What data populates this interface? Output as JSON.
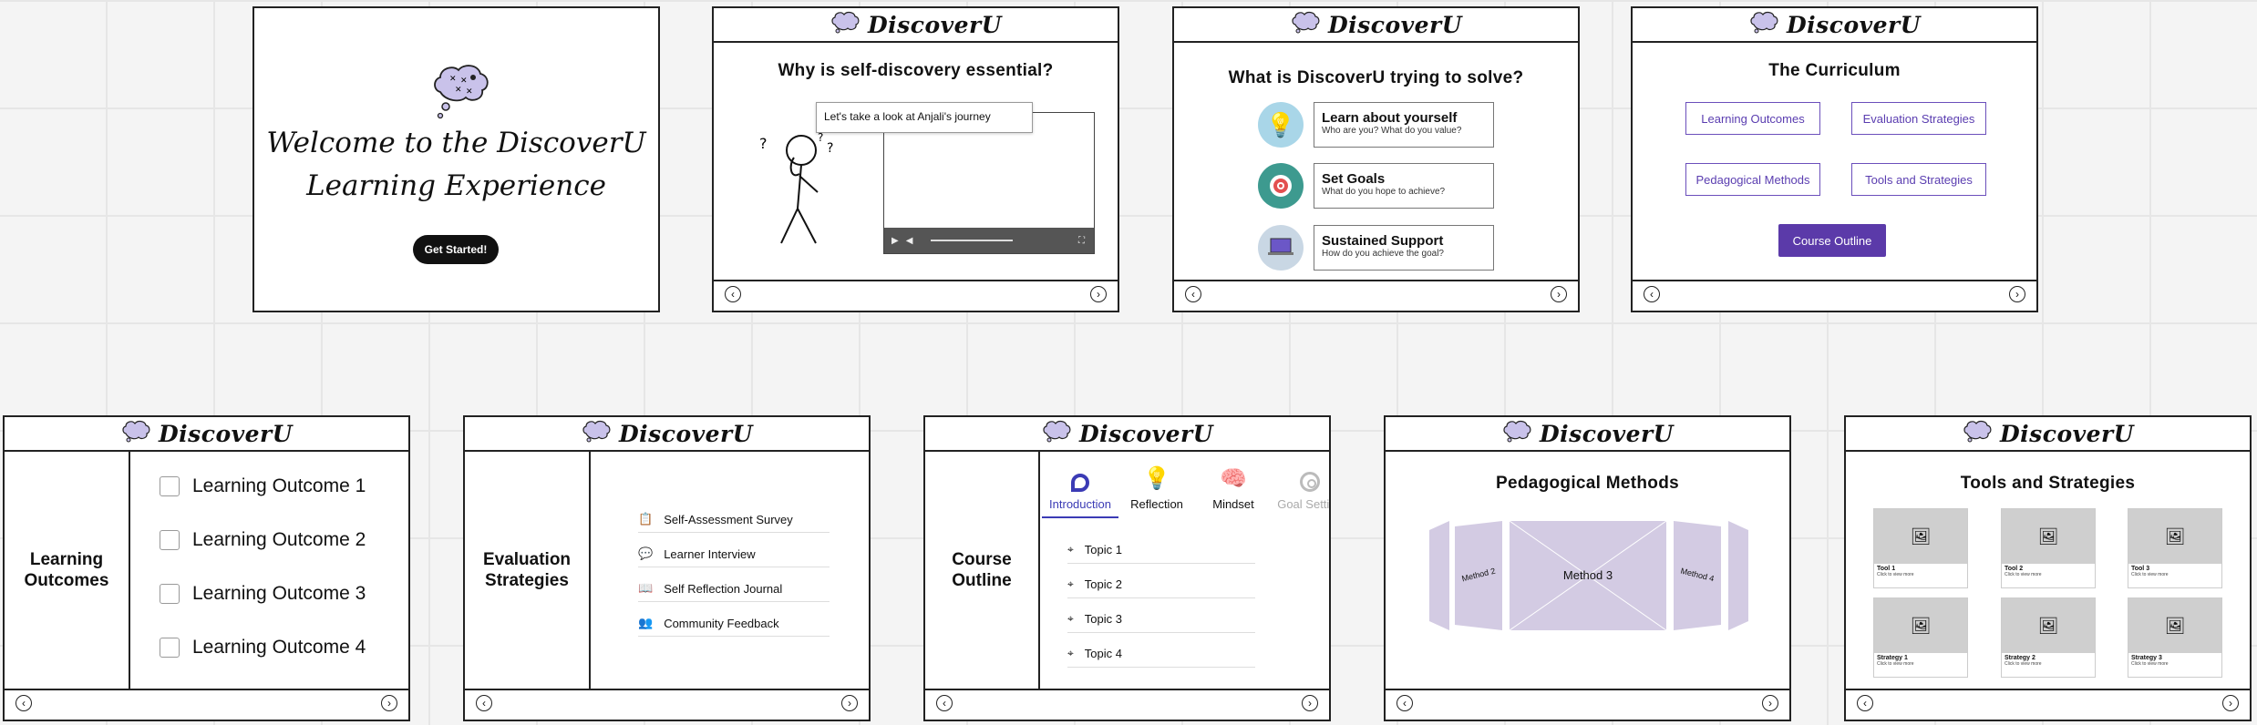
{
  "brand": "DiscoverU",
  "slide1": {
    "title_line1": "Welcome to the DiscoverU",
    "title_line2": "Learning Experience",
    "button": "Get Started!"
  },
  "slide2": {
    "title": "Why is self-discovery essential?",
    "caption": "Let's take a look at Anjali's journey"
  },
  "slide3": {
    "title": "What is DiscoverU trying to solve?",
    "cards": [
      {
        "title": "Learn about yourself",
        "subtitle": "Who are you? What do you value?",
        "icon": "lightbulb-icon",
        "color": "#a9d6e8"
      },
      {
        "title": "Set Goals",
        "subtitle": "What do you hope to achieve?",
        "icon": "target-icon",
        "color": "#3d9a8f"
      },
      {
        "title": "Sustained Support",
        "subtitle": "How do you achieve the goal?",
        "icon": "laptop-icon",
        "color": "#c9d7e4"
      }
    ]
  },
  "slide4": {
    "title": "The Curriculum",
    "buttons": [
      "Learning Outcomes",
      "Evaluation Strategies",
      "Pedagogical Methods",
      "Tools and Strategies"
    ],
    "primary": "Course Outline",
    "accent": "#5b3aa9"
  },
  "slide5": {
    "sidebar_line1": "Learning",
    "sidebar_line2": "Outcomes",
    "items": [
      "Learning Outcome 1",
      "Learning Outcome 2",
      "Learning Outcome 3",
      "Learning Outcome 4"
    ]
  },
  "slide6": {
    "sidebar_line1": "Evaluation",
    "sidebar_line2": "Strategies",
    "items": [
      {
        "label": "Self-Assessment Survey",
        "icon": "clipboard-icon"
      },
      {
        "label": "Learner Interview",
        "icon": "chat-icon"
      },
      {
        "label": "Self Reflection Journal",
        "icon": "book-icon"
      },
      {
        "label": "Community Feedback",
        "icon": "people-icon"
      }
    ]
  },
  "slide7": {
    "sidebar_line1": "Course",
    "sidebar_line2": "Outline",
    "tabs": [
      {
        "label": "Introduction",
        "icon": "chat-bubble-icon",
        "active": true
      },
      {
        "label": "Reflection",
        "icon": "lightbulb-icon",
        "active": false
      },
      {
        "label": "Mindset",
        "icon": "brain-icon",
        "active": false
      },
      {
        "label": "Goal Setting",
        "icon": "target-icon",
        "active": false
      }
    ],
    "topics": [
      "Topic 1",
      "Topic 2",
      "Topic 3",
      "Topic 4"
    ],
    "active_color": "#3b3bb5"
  },
  "slide8": {
    "title": "Pedagogical Methods",
    "center": "Method 3",
    "left": "Method 2",
    "right": "Method 4",
    "color": "#d3cbe3"
  },
  "slide9": {
    "title": "Tools and Strategies",
    "tiles": [
      {
        "label": "Tool 1",
        "desc": "Click to view more"
      },
      {
        "label": "Tool 2",
        "desc": "Click to view more"
      },
      {
        "label": "Tool 3",
        "desc": "Click to view more"
      },
      {
        "label": "Strategy 1",
        "desc": "Click to view more"
      },
      {
        "label": "Strategy 2",
        "desc": "Click to view more"
      },
      {
        "label": "Strategy 3",
        "desc": "Click to view more"
      }
    ]
  }
}
